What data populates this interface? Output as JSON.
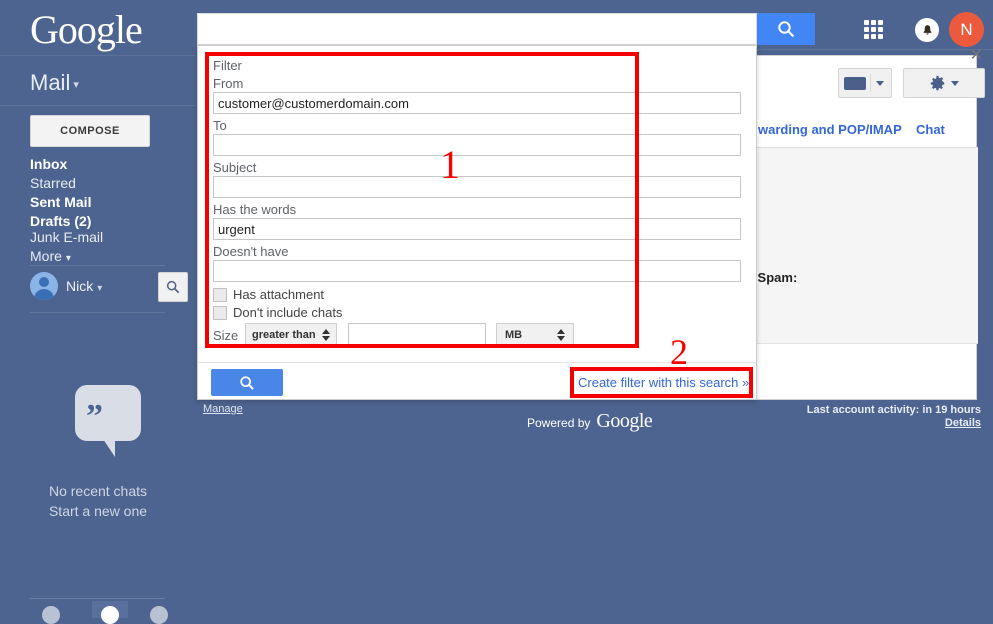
{
  "brand": {
    "logo": "Google",
    "powered_by": "Powered by",
    "powered_by_mark": "Google"
  },
  "sidebar": {
    "product": "Mail",
    "product_caret": "▾",
    "compose_label": "COMPOSE",
    "nav": [
      {
        "label": "Inbox",
        "bold": true
      },
      {
        "label": "Starred",
        "bold": false
      },
      {
        "label": "Sent Mail",
        "bold": false
      },
      {
        "label": "Drafts (2)",
        "bold": true
      },
      {
        "label": "Junk E-mail",
        "bold": false
      },
      {
        "label": "More",
        "bold": false
      }
    ],
    "more_caret": "▾",
    "user_name": "Nick",
    "user_caret": "▾",
    "search_icon": "search-icon",
    "chat": {
      "quote_glyph": "”",
      "empty_title": "No recent chats",
      "empty_action": "Start a new one"
    }
  },
  "topbar": {
    "search_value": "",
    "search_placeholder": "",
    "search_button_icon": "search-icon",
    "apps_icon": "apps-grid-icon",
    "notifications_icon": "bell-icon",
    "avatar_initial": "N",
    "keyboard_icon": "keyboard-icon",
    "gear_icon": "gear-icon"
  },
  "settings_page": {
    "tabs": [
      {
        "label": "warding and POP/IMAP"
      },
      {
        "label": "Chat"
      }
    ],
    "spam_label": "n Spam:"
  },
  "filter_panel": {
    "title": "Filter",
    "close_icon": "close-icon",
    "fields": [
      {
        "label": "From",
        "value": "customer@customerdomain.com"
      },
      {
        "label": "To",
        "value": ""
      },
      {
        "label": "Subject",
        "value": ""
      },
      {
        "label": "Has the words",
        "value": "urgent"
      },
      {
        "label": "Doesn't have",
        "value": ""
      }
    ],
    "checkboxes": [
      {
        "label": "Has attachment",
        "checked": false
      },
      {
        "label": "Don't include chats",
        "checked": false
      }
    ],
    "size": {
      "label": "Size",
      "operator": "greater than",
      "amount": "",
      "unit": "MB"
    },
    "search_button_icon": "search-icon",
    "create_filter_link": "Create filter with this search »"
  },
  "footer": {
    "manage": "Manage",
    "last_activity": "Last account activity: in 19 hours",
    "details": "Details"
  },
  "annotations": [
    {
      "number": "1",
      "target": "filter-fields-region"
    },
    {
      "number": "2",
      "target": "create-filter-link"
    }
  ],
  "colors": {
    "page_background": "#4e6490",
    "accent_blue": "#4285f4",
    "link_blue": "#3367d6",
    "annotation_red": "#f40000",
    "avatar_orange": "#eb5a3c"
  }
}
